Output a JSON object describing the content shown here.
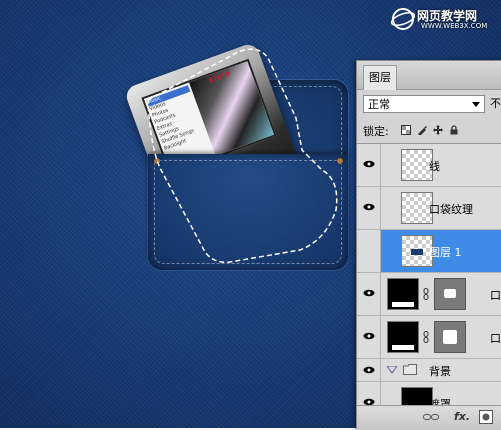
{
  "watermark": {
    "site_cn": "网页教学网",
    "site_url": "WWW.WEB3X.COM"
  },
  "ipod": {
    "screen_title": "EIEID",
    "menu_items": [
      "Music",
      "Videos",
      "Photos",
      "Podcasts",
      "Extras",
      "Settings",
      "Shuffle Songs",
      "Backlight"
    ]
  },
  "layers_panel": {
    "tab_label": "图层",
    "blend_mode": "正常",
    "opacity_label": "不",
    "lock_label": "锁定:",
    "layers": [
      {
        "name": "线",
        "thumb": "transparent",
        "active": false
      },
      {
        "name": "口袋纹理",
        "thumb": "transparent",
        "active": false
      },
      {
        "name": "图层 1",
        "thumb": "transparent-dark",
        "active": true
      },
      {
        "name": "口",
        "thumb": "black-with-mask",
        "active": false
      },
      {
        "name": "口",
        "thumb": "black-with-mask",
        "active": false
      }
    ],
    "group": {
      "name": "背景"
    },
    "group_layers": [
      {
        "name": "遮罩",
        "thumb": "black"
      }
    ],
    "footer": {
      "link_icon": "link-icon",
      "fx_label": "fx.",
      "mask_icon": "add-mask-icon"
    }
  }
}
